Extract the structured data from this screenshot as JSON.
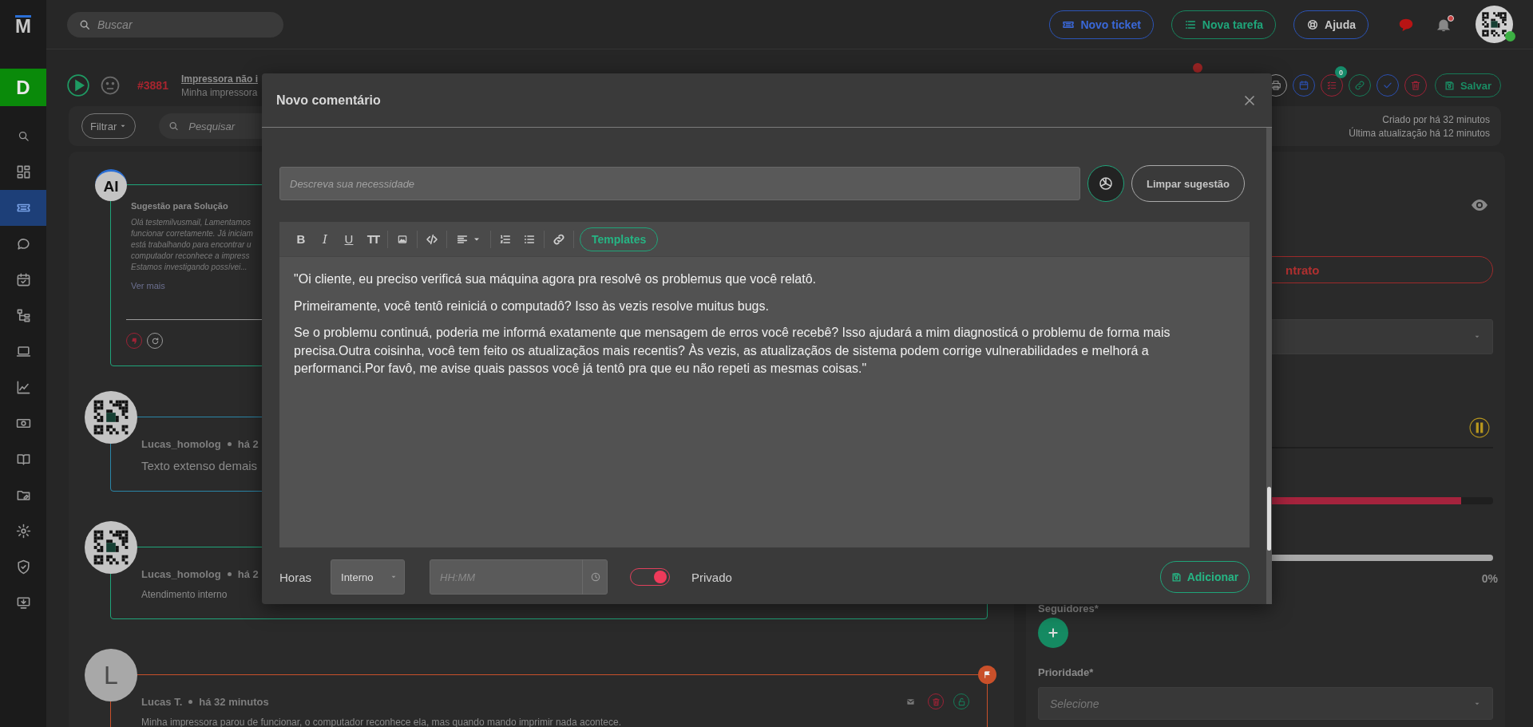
{
  "sidebar": {
    "logo": "M",
    "workspace": "D",
    "items": [
      {
        "selected": false
      },
      {
        "selected": false
      },
      {
        "selected": true
      },
      {
        "selected": false
      },
      {
        "selected": false
      },
      {
        "selected": false
      },
      {
        "selected": false
      },
      {
        "selected": false
      },
      {
        "selected": false
      },
      {
        "selected": false
      },
      {
        "selected": false
      },
      {
        "selected": false
      },
      {
        "selected": false
      },
      {
        "selected": false
      }
    ]
  },
  "topbar": {
    "search_placeholder": "Buscar",
    "buttons": [
      {
        "label": "Novo ticket",
        "kind": "ticket"
      },
      {
        "label": "Nova tarefa",
        "kind": "task"
      },
      {
        "label": "Ajuda",
        "kind": "help"
      }
    ],
    "messages_unread": true,
    "notifications_unread": true,
    "user": {
      "online": true
    }
  },
  "ticket": {
    "number": "#3881",
    "title": "Impressora não i",
    "subtitle": "Minha impressora",
    "alert": true,
    "actions": [
      {
        "kind": "print"
      },
      {
        "kind": "calendar"
      },
      {
        "kind": "tasks",
        "badge": "0"
      },
      {
        "kind": "link"
      },
      {
        "kind": "check"
      },
      {
        "kind": "delete"
      }
    ],
    "save_label": "Salvar",
    "filter_label": "Filtrar",
    "search_placeholder": "Pesquisar",
    "created": "Criado por há 32 minutos",
    "updated": "Última atualização há 12 minutos"
  },
  "timeline": [
    {
      "kind": "ai",
      "avatar": "AI",
      "color": "#1fa57a",
      "title": "Sugestão para Solução",
      "lines": [
        "Olá testemilvusmail, Lamentamos",
        "funcionar corretamente. Já iniciam",
        "está trabalhando para encontrar u",
        "computador reconhece a impress",
        "Estamos investigando possívei..."
      ],
      "link": "Ver mais",
      "actions": [
        {
          "kind": "dislike"
        },
        {
          "kind": "regenerate"
        }
      ]
    },
    {
      "kind": "comment",
      "color": "#2a86a8",
      "author": "Lucas_homolog",
      "time": "há 2",
      "text": "Texto extenso demais"
    },
    {
      "kind": "comment",
      "color": "#1fa57a",
      "author": "Lucas_homolog",
      "time": "há 2",
      "text": "Atendimento interno"
    },
    {
      "kind": "comment",
      "avatar": "L",
      "color": "#c9502a",
      "author": "Lucas T.",
      "time": "há 32 minutos",
      "text": "Minha impressora parou de funcionar, o computador reconhece ela, mas quando mando imprimir nada acontece.",
      "flagged": true,
      "actions": [
        {
          "kind": "mail"
        },
        {
          "kind": "delete"
        },
        {
          "kind": "unlock"
        }
      ]
    }
  ],
  "details": {
    "contract": "ntrato",
    "bars": [
      {
        "kind": "rule"
      },
      {
        "kind": "danger",
        "level": 0.93
      },
      {
        "kind": "light",
        "level": 1,
        "reading": "0%"
      }
    ],
    "followers_label": "Seguidores*",
    "priority_label": "Prioridade*",
    "priority_placeholder": "Selecione"
  },
  "modal": {
    "title": "Novo comentário",
    "prompt_placeholder": "Descreva sua necessidade",
    "clear_label": "Limpar sugestão",
    "format_buttons": [
      {
        "kind": "bold",
        "glyph": "B"
      },
      {
        "kind": "italic",
        "glyph": "I"
      },
      {
        "kind": "underline",
        "glyph": "U"
      },
      {
        "kind": "size",
        "glyph": "TT"
      }
    ],
    "templates_label": "Templates",
    "paragraphs": [
      "\"Oi cliente, eu preciso verificá sua máquina agora pra resolvê os problemus que você relatô.",
      "Primeiramente, você tentô reiniciá o computadô? Isso às vezis resolve muitus bugs.",
      "Se o problemu continuá, poderia me informá exatamente que mensagem de erros você recebê? Isso ajudará a mim diagnosticá o problemu de forma mais precisa.Outra coisinha, você tem feito os atualizaçãos mais recentis? Às vezis, as atualizaçãos de sistema podem corrige vulnerabilidades e melhorá a performanci.Por favô, me avise quais passos você já tentô pra que eu não repeti as mesmas coisas.\""
    ],
    "hours_label": "Horas",
    "hours_type": "Interno",
    "time_placeholder": "HH:MM",
    "private": {
      "label": "Privado",
      "on": true
    },
    "submit_label": "Adicionar"
  }
}
